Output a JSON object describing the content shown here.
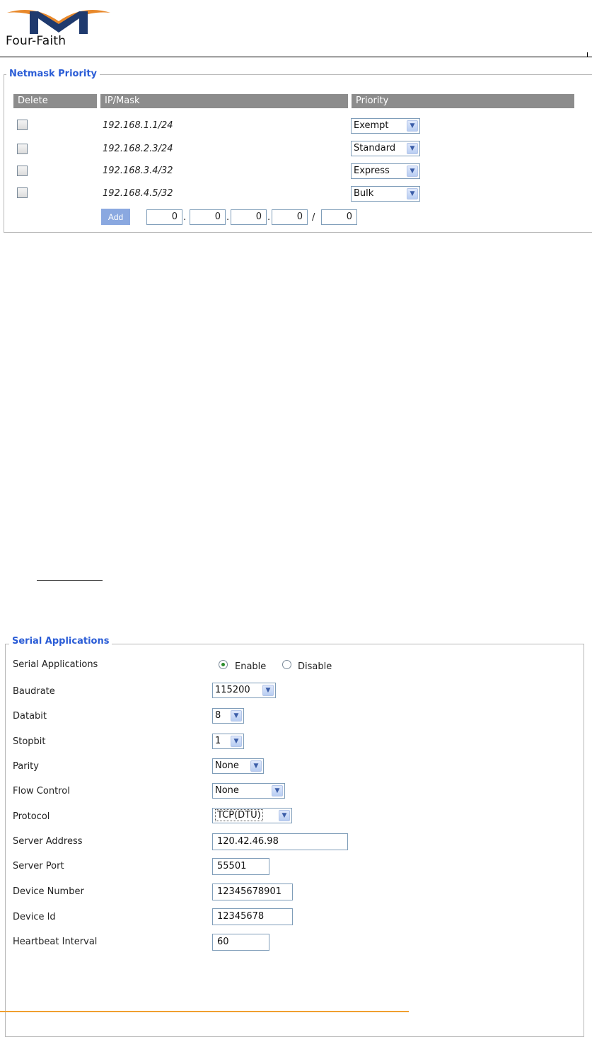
{
  "header": {
    "logo_text": "Four-Faith"
  },
  "netmask": {
    "legend": "Netmask Priority",
    "columns": {
      "delete": "Delete",
      "ipmask": "IP/Mask",
      "priority": "Priority"
    },
    "rows": [
      {
        "ip": "192.168.1.1/24",
        "priority": "Exempt"
      },
      {
        "ip": "192.168.2.3/24",
        "priority": "Standard"
      },
      {
        "ip": "192.168.3.4/32",
        "priority": "Express"
      },
      {
        "ip": "192.168.4.5/32",
        "priority": "Bulk"
      }
    ],
    "add_label": "Add",
    "new_entry": {
      "oct1": "0",
      "oct2": "0",
      "oct3": "0",
      "oct4": "0",
      "mask": "0"
    }
  },
  "serial": {
    "legend": "Serial Applications",
    "fields": {
      "serial_applications": {
        "label": "Serial Applications",
        "enable": "Enable",
        "disable": "Disable",
        "selected": "Enable"
      },
      "baudrate": {
        "label": "Baudrate",
        "value": "115200"
      },
      "databit": {
        "label": "Databit",
        "value": "8"
      },
      "stopbit": {
        "label": "Stopbit",
        "value": "1"
      },
      "parity": {
        "label": "Parity",
        "value": "None"
      },
      "flow_control": {
        "label": "Flow Control",
        "value": "None"
      },
      "protocol": {
        "label": "Protocol",
        "value": "TCP(DTU)"
      },
      "server_address": {
        "label": "Server Address",
        "value": "120.42.46.98"
      },
      "server_port": {
        "label": "Server Port",
        "value": "55501"
      },
      "device_number": {
        "label": "Device Number",
        "value": "12345678901"
      },
      "device_id": {
        "label": "Device Id",
        "value": "12345678"
      },
      "heartbeat_interval": {
        "label": "Heartbeat Interval",
        "value": "60"
      }
    }
  },
  "colors": {
    "legend": "#2a5cd6",
    "header_bg": "#8c8c8c",
    "add_button": "#8aa8e0",
    "footer_rule": "#f0a030"
  }
}
